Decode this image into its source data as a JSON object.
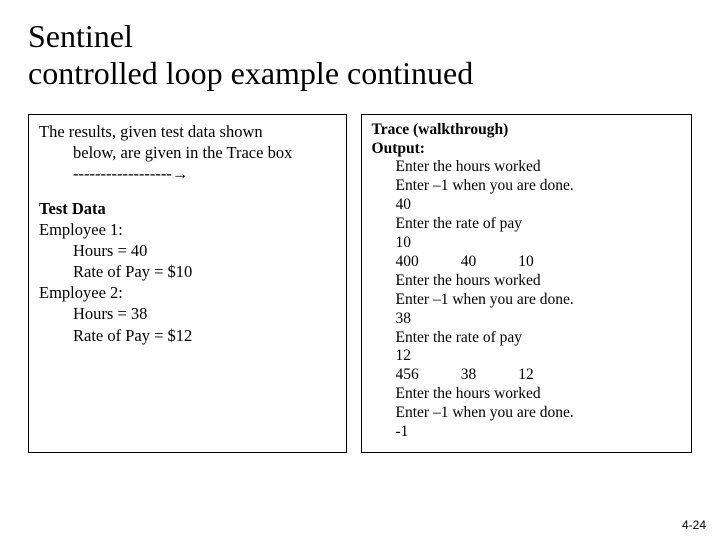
{
  "title_line1": "Sentinel",
  "title_line2": "controlled loop example continued",
  "left": {
    "intro1": "The results, given test data shown",
    "intro2": "below, are given in the Trace box",
    "dashes": "------------------",
    "arrow": "→",
    "test_data_heading": "Test Data",
    "emp1_label": "Employee 1:",
    "emp1_hours": "Hours = 40",
    "emp1_rate": "Rate of Pay = $10",
    "emp2_label": "Employee 2:",
    "emp2_hours": "Hours = 38",
    "emp2_rate": "Rate of Pay = $12"
  },
  "right": {
    "trace_heading": "Trace (walkthrough)",
    "output_heading": "Output:",
    "lines": {
      "l1": "Enter the hours worked",
      "l2": "Enter –1 when you are done.",
      "l3": "40",
      "l4": "Enter the rate of pay",
      "l5": "10",
      "l6a": "400",
      "l6b": "40",
      "l6c": "10",
      "l7": "Enter the hours worked",
      "l8": "Enter –1 when you are done.",
      "l9": "38",
      "l10": "Enter the rate of pay",
      "l11": "12",
      "l12a": "456",
      "l12b": "38",
      "l12c": "12",
      "l13": "Enter the hours worked",
      "l14": "Enter –1 when you are done.",
      "l15": "-1"
    }
  },
  "page_number": "4-24"
}
